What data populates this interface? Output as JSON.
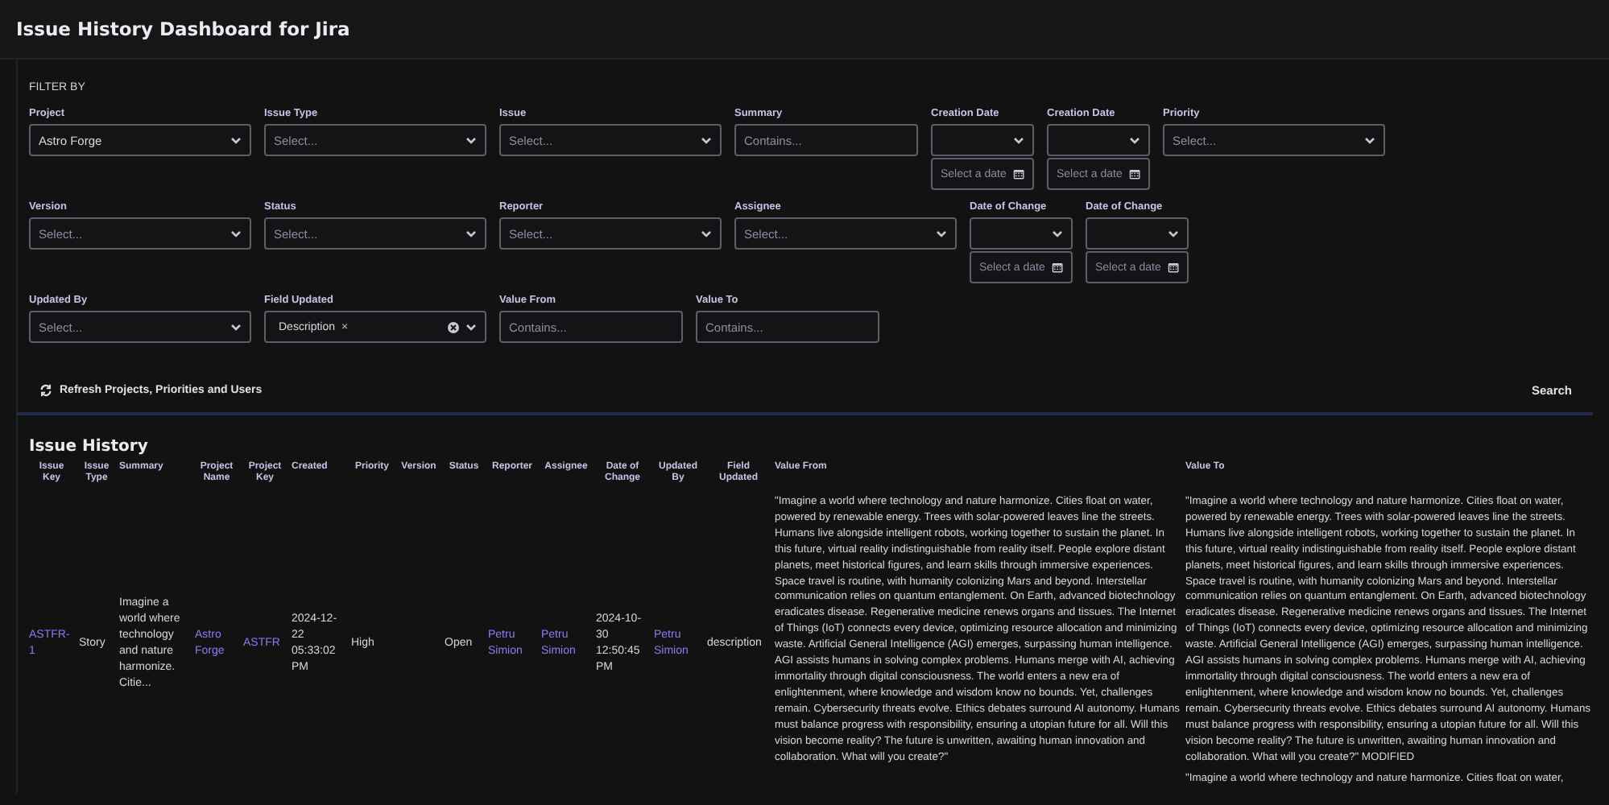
{
  "window": {
    "title": "Issue History Dashboard for Jira"
  },
  "filters": {
    "heading": "FILTER BY",
    "rows": [
      [
        {
          "kind": "select",
          "label": "Project",
          "value": "Astro Forge"
        },
        {
          "kind": "select",
          "label": "Issue Type",
          "placeholder": "Select..."
        },
        {
          "kind": "select",
          "label": "Issue",
          "placeholder": "Select..."
        },
        {
          "kind": "text",
          "label": "Summary",
          "placeholder": "Contains..."
        },
        {
          "kind": "date",
          "label": "Creation Date",
          "placeholder": "Select a date"
        },
        {
          "kind": "date",
          "label": "Creation Date",
          "placeholder": "Select a date"
        },
        {
          "kind": "select",
          "label": "Priority",
          "placeholder": "Select..."
        }
      ],
      [
        {
          "kind": "select",
          "label": "Version",
          "placeholder": "Select..."
        },
        {
          "kind": "select",
          "label": "Status",
          "placeholder": "Select..."
        },
        {
          "kind": "select",
          "label": "Reporter",
          "placeholder": "Select..."
        },
        {
          "kind": "select",
          "label": "Assignee",
          "placeholder": "Select..."
        },
        {
          "kind": "date",
          "label": "Date of Change",
          "placeholder": "Select a date"
        },
        {
          "kind": "date",
          "label": "Date of Change",
          "placeholder": "Select a date"
        }
      ],
      [
        {
          "kind": "select",
          "label": "Updated By",
          "placeholder": "Select..."
        },
        {
          "kind": "multiselect",
          "label": "Field Updated",
          "chips": [
            {
              "label": "Description",
              "remove": "×"
            }
          ]
        },
        {
          "kind": "text",
          "label": "Value From",
          "placeholder": "Contains..."
        },
        {
          "kind": "text",
          "label": "Value To",
          "placeholder": "Contains..."
        }
      ]
    ],
    "refresh_button": "Refresh Projects, Priorities and Users",
    "search_button": "Search"
  },
  "issue_history": {
    "title": "Issue History",
    "columns": [
      "Issue Key",
      "Issue Type",
      "Summary",
      "Project Name",
      "Project Key",
      "Created",
      "Priority",
      "Version",
      "Status",
      "Reporter",
      "Assignee",
      "Date of Change",
      "Updated By",
      "Field Updated",
      "Value From",
      "Value To"
    ],
    "rows": [
      {
        "cells": [
          {
            "kind": "link",
            "text": "ASTFR-1"
          },
          {
            "kind": "text",
            "text": "Story"
          },
          {
            "kind": "text",
            "text": "Imagine a world where technology and nature harmonize. Citie..."
          },
          {
            "kind": "link",
            "text": "Astro Forge"
          },
          {
            "kind": "link",
            "text": "ASTFR"
          },
          {
            "kind": "text",
            "text": "2024-12-22 05:33:02 PM"
          },
          {
            "kind": "text",
            "text": "High"
          },
          {
            "kind": "text",
            "text": ""
          },
          {
            "kind": "text",
            "text": "Open"
          },
          {
            "kind": "link",
            "text": "Petru Simion"
          },
          {
            "kind": "link",
            "text": "Petru Simion"
          },
          {
            "kind": "text",
            "text": "2024-10-30 12:50:45 PM"
          },
          {
            "kind": "link",
            "text": "Petru Simion"
          },
          {
            "kind": "text",
            "text": "description"
          },
          {
            "kind": "long",
            "paragraphs": [
              {
                "text": "\"Imagine a world where technology and nature harmonize. Cities float on water, powered by renewable energy. Trees with solar-powered leaves line the streets. Humans live alongside intelligent robots, working together to sustain the planet. In this future, virtual reality indistinguishable from reality itself. People explore distant planets, meet historical figures, and learn skills through immersive experiences. Space travel is routine, with humanity colonizing Mars and beyond. Interstellar communication relies on quantum entanglement. On Earth, advanced biotechnology eradicates disease. Regenerative medicine renews organs and tissues. The Internet of Things (IoT) connects every device, optimizing resource allocation and minimizing waste. Artificial General Intelligence (AGI) emerges, surpassing human intelligence. AGI assists humans in solving complex problems. Humans merge with AI, achieving immortality through digital consciousness. The world enters a new era of enlightenment, where knowledge and wisdom know no bounds. Yet, challenges remain. Cybersecurity threats evolve. Ethics debates surround AI autonomy. Humans must balance progress with responsibility, ensuring a utopian future for all. Will this vision become reality? The future is unwritten, awaiting human innovation and collaboration. What will you create?\""
              }
            ]
          },
          {
            "kind": "long",
            "paragraphs": [
              {
                "text": "\"Imagine a world where technology and nature harmonize. Cities float on water, powered by renewable energy. Trees with solar-powered leaves line the streets. Humans live alongside intelligent robots, working together to sustain the planet. In this future, virtual reality indistinguishable from reality itself. People explore distant planets, meet historical figures, and learn skills through immersive experiences. Space travel is routine, with humanity colonizing Mars and beyond. Interstellar communication relies on quantum entanglement. On Earth, advanced biotechnology eradicates disease. Regenerative medicine renews organs and tissues. The Internet of Things (IoT) connects every device, optimizing resource allocation and minimizing waste. Artificial General Intelligence (AGI) emerges, surpassing human intelligence. AGI assists humans in solving complex problems. Humans merge with AI, achieving immortality through digital consciousness. The world enters a new era of enlightenment, where knowledge and wisdom know no bounds. Yet, challenges remain. Cybersecurity threats evolve. Ethics debates surround AI autonomy. Humans must balance progress with responsibility, ensuring a utopian future for all. Will this vision become reality? The future is unwritten, awaiting human innovation and collaboration. What will you create?\" MODIFIED"
              },
              {
                "text": "\"Imagine a world where technology and nature harmonize. Cities float on water,"
              }
            ]
          }
        ]
      }
    ]
  }
}
